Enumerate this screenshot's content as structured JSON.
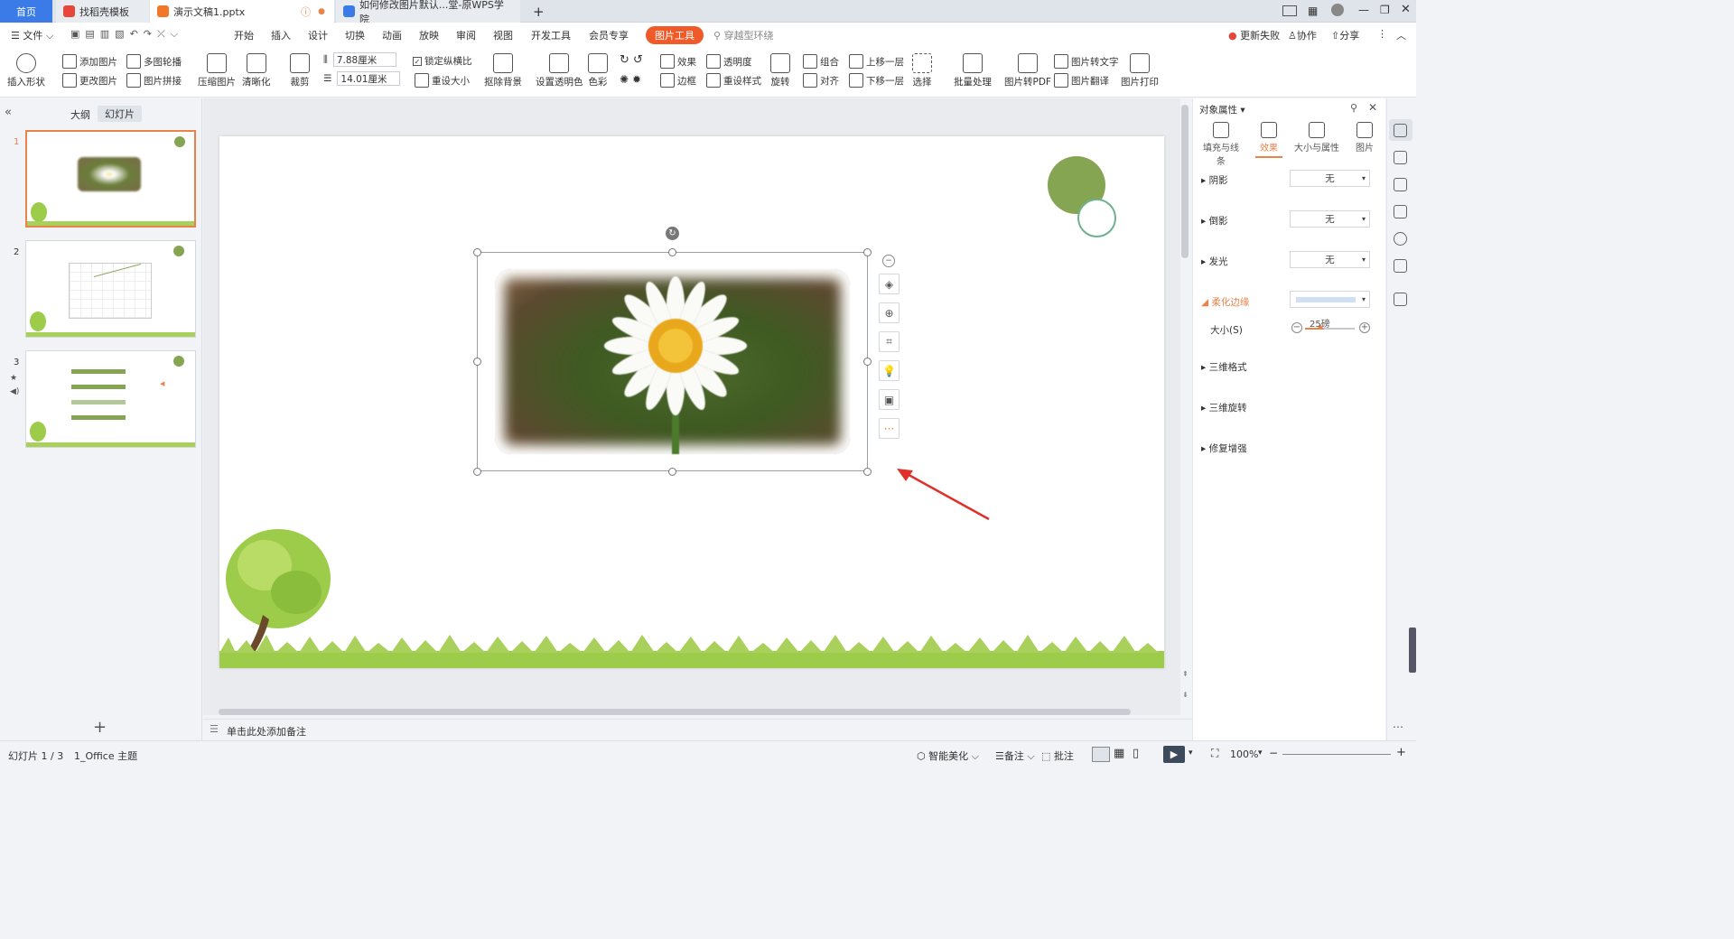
{
  "tabs": {
    "home": "首页",
    "t1": "找稻壳模板",
    "t2": "演示文稿1.pptx",
    "t3": "如何修改图片默认...堂-原WPS学院",
    "add": "+"
  },
  "menu": {
    "file": "文件",
    "items": [
      "开始",
      "插入",
      "设计",
      "切换",
      "动画",
      "放映",
      "审阅",
      "视图",
      "开发工具",
      "会员专享"
    ],
    "active": "图片工具",
    "search": "穿越型环绕",
    "update": "更新失败",
    "collab": "协作",
    "share": "分享"
  },
  "ribbon": {
    "insert_shape": "插入形状",
    "add_image": "添加图片",
    "multi_outline": "多图轮播",
    "change_image": "更改图片",
    "image_join": "图片拼接",
    "compress": "压缩图片",
    "clarify": "清晰化",
    "crop": "裁剪",
    "width": "7.88厘米",
    "height": "14.01厘米",
    "lock_ratio": "锁定纵横比",
    "reset_size": "重设大小",
    "remove_bg": "抠除背景",
    "set_transparent": "设置透明色",
    "color": "色彩",
    "effect": "效果",
    "transparency": "透明度",
    "border": "边框",
    "reset_style": "重设样式",
    "rotate": "旋转",
    "group": "组合",
    "align": "对齐",
    "up": "上移一层",
    "down": "下移一层",
    "select": "选择",
    "batch": "批量处理",
    "to_pdf": "图片转PDF",
    "to_text": "图片转文字",
    "translate": "图片翻译",
    "print": "图片打印"
  },
  "left": {
    "tab_outline": "大纲",
    "tab_slides": "幻灯片",
    "nums": [
      "1",
      "2",
      "3"
    ],
    "add": "+"
  },
  "notes": "单击此处添加备注",
  "right": {
    "title": "对象属性",
    "tabs": [
      "填充与线条",
      "效果",
      "大小与属性",
      "图片"
    ],
    "shadow": "阴影",
    "reflection": "倒影",
    "glow": "发光",
    "none": "无",
    "soft_edge": "柔化边缘",
    "size_label": "大小(S)",
    "size_value": "25磅",
    "size_percent": 0.3,
    "three_d_format": "三维格式",
    "three_d_rotate": "三维旋转",
    "repair": "修复增强"
  },
  "status": {
    "slide": "幻灯片 1 / 3",
    "theme": "1_Office 主题",
    "beautify": "智能美化",
    "notes": "备注",
    "comment": "批注",
    "zoom": "100%"
  },
  "colors": {
    "accent": "#3b7be8",
    "brand": "#e8834a",
    "tool_active": "#f05a28",
    "green": "#85a552"
  }
}
